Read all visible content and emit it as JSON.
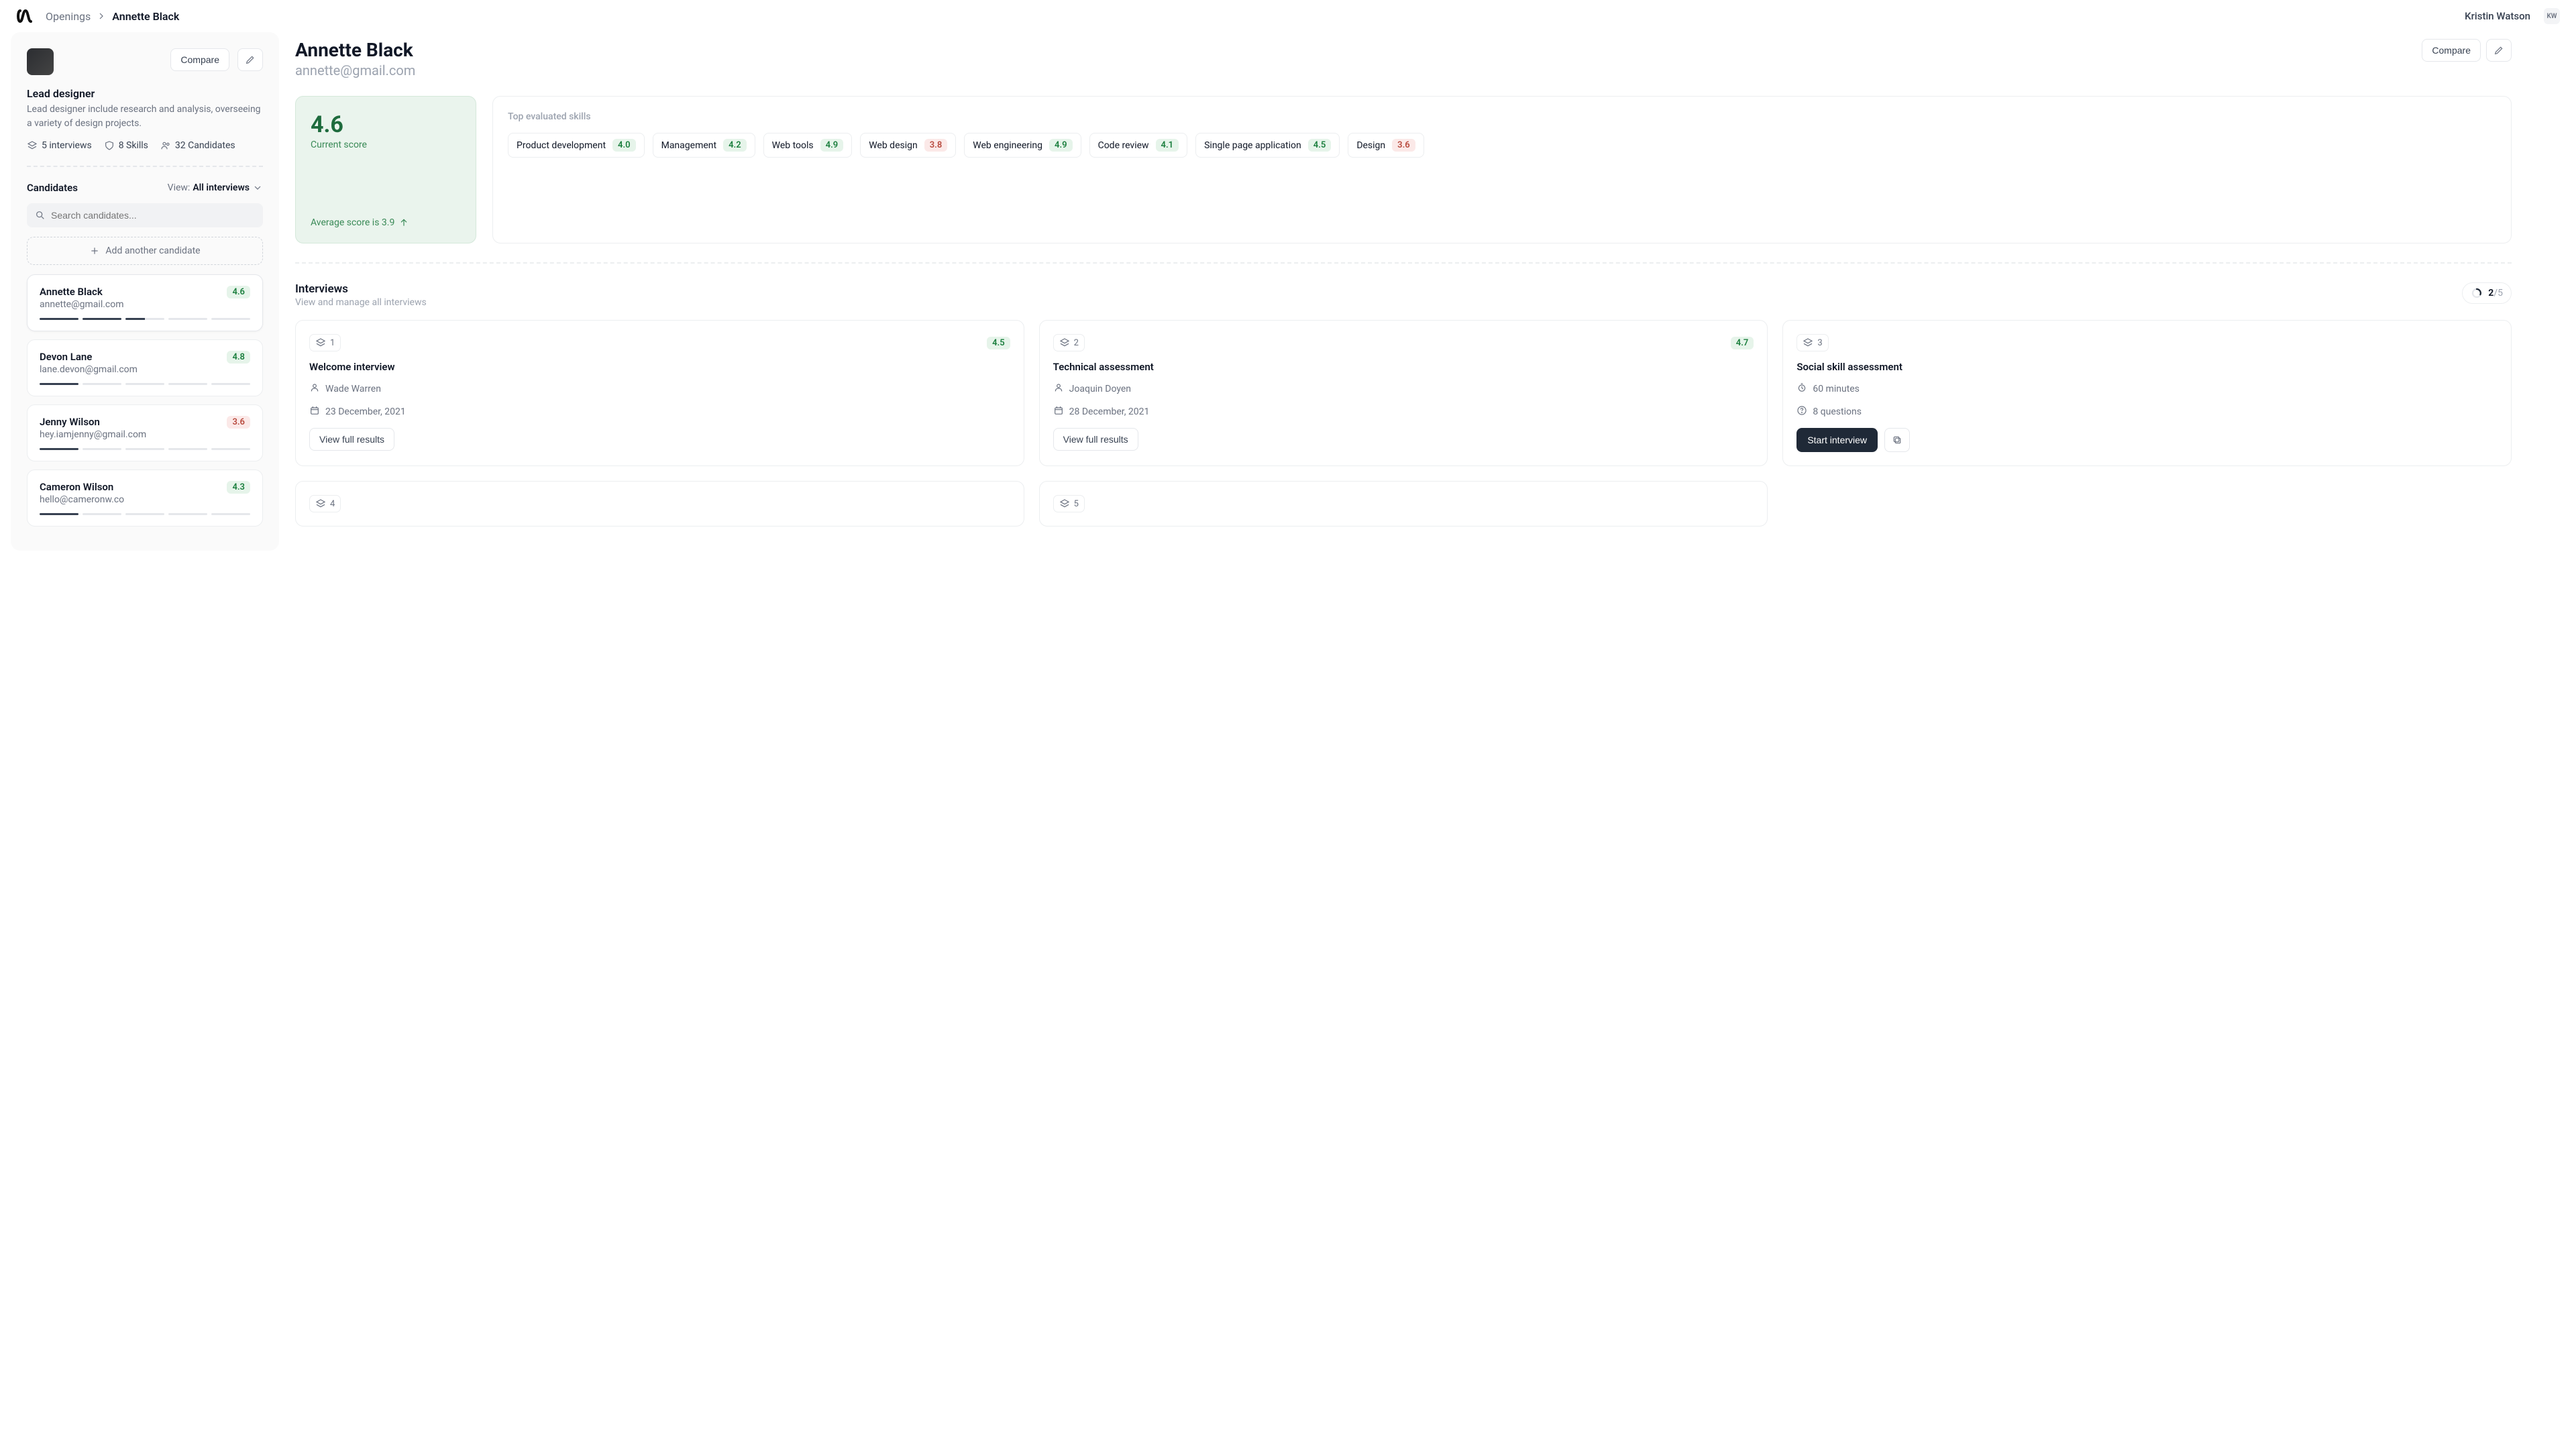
{
  "breadcrumb": {
    "root": "Openings",
    "current": "Annette Black"
  },
  "user": {
    "name": "Kristin Watson",
    "initials": "KW"
  },
  "role": {
    "title": "Lead designer",
    "description": "Lead designer include research and analysis, overseeing a variety of design projects.",
    "interviews_stat": "5 interviews",
    "skills_stat": "8 Skills",
    "candidates_stat": "32 Candidates",
    "compare_btn": "Compare"
  },
  "side": {
    "candidates_label": "Candidates",
    "view_label": "View:",
    "view_value": "All interviews",
    "search_placeholder": "Search candidates...",
    "add_label": "Add another candidate"
  },
  "candidates": [
    {
      "name": "Annette Black",
      "email": "annette@gmail.com",
      "score": "4.6",
      "tone": "green",
      "bars": [
        1,
        1,
        0.5,
        0,
        0
      ]
    },
    {
      "name": "Devon Lane",
      "email": "lane.devon@gmail.com",
      "score": "4.8",
      "tone": "green",
      "bars": [
        1,
        0,
        0,
        0,
        0
      ]
    },
    {
      "name": "Jenny Wilson",
      "email": "hey.iamjenny@gmail.com",
      "score": "3.6",
      "tone": "red",
      "bars": [
        1,
        0,
        0,
        0,
        0
      ]
    },
    {
      "name": "Cameron Wilson",
      "email": "hello@cameronw.co",
      "score": "4.3",
      "tone": "green",
      "bars": [
        1,
        0,
        0,
        0,
        0
      ]
    }
  ],
  "main": {
    "name": "Annette Black",
    "email": "annette@gmail.com",
    "compare_btn": "Compare",
    "score": "4.6",
    "score_label": "Current score",
    "avg_label": "Average score is 3.9"
  },
  "skills": {
    "title": "Top evaluated skills",
    "items": [
      {
        "label": "Product development",
        "score": "4.0",
        "tone": "green"
      },
      {
        "label": "Management",
        "score": "4.2",
        "tone": "green"
      },
      {
        "label": "Web tools",
        "score": "4.9",
        "tone": "green"
      },
      {
        "label": "Web design",
        "score": "3.8",
        "tone": "red"
      },
      {
        "label": "Web engineering",
        "score": "4.9",
        "tone": "green"
      },
      {
        "label": "Code review",
        "score": "4.1",
        "tone": "green"
      },
      {
        "label": "Single page application",
        "score": "4.5",
        "tone": "green"
      },
      {
        "label": "Design",
        "score": "3.6",
        "tone": "red"
      }
    ]
  },
  "interviews": {
    "title": "Interviews",
    "subtitle": "View and manage all interviews",
    "progress_done": "2",
    "progress_total": "/5"
  },
  "cards": [
    {
      "num": "1",
      "score": "4.5",
      "title": "Welcome interview",
      "meta1": "Wade Warren",
      "meta1_icon": "user",
      "meta2": "23 December, 2021",
      "meta2_icon": "calendar",
      "action": "View full results",
      "type": "done"
    },
    {
      "num": "2",
      "score": "4.7",
      "title": "Technical assessment",
      "meta1": "Joaquin Doyen",
      "meta1_icon": "user",
      "meta2": "28 December, 2021",
      "meta2_icon": "calendar",
      "action": "View full results",
      "type": "done"
    },
    {
      "num": "3",
      "score": "",
      "title": "Social skill assessment",
      "meta1": "60 minutes",
      "meta1_icon": "clock",
      "meta2": "8 questions",
      "meta2_icon": "help",
      "action": "Start interview",
      "type": "pending"
    },
    {
      "num": "4",
      "type": "stub"
    },
    {
      "num": "5",
      "type": "stub"
    }
  ]
}
